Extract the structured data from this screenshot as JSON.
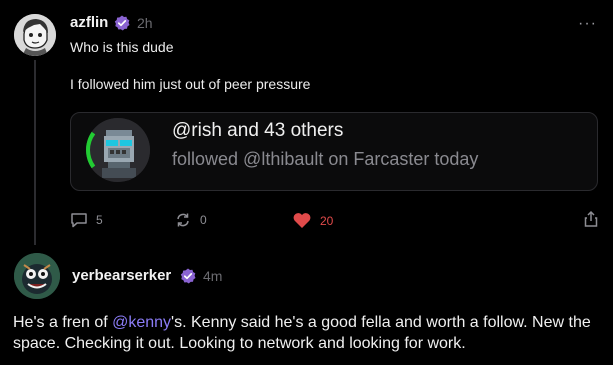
{
  "post1": {
    "username": "azflin",
    "time": "2h",
    "line1": "Who is this dude",
    "line2": "I followed him just out of peer pressure",
    "more": "···",
    "embed": {
      "title": "@rish and 43 others",
      "subtitle": "followed @lthibault on Farcaster today"
    },
    "actions": {
      "replies": "5",
      "recasts": "0",
      "likes": "20"
    }
  },
  "post2": {
    "username": "yerbearserker",
    "time": "4m",
    "text_before": "He's a fren of ",
    "mention": "@kenny",
    "text_after": "'s. Kenny said he's a good fella and worth a follow. New the space. Checking it out. Looking to network and looking for work."
  },
  "colors": {
    "background": "#000000",
    "verified": "#8a63d2",
    "mention": "#8b7cf6",
    "like": "#e04a4a"
  }
}
